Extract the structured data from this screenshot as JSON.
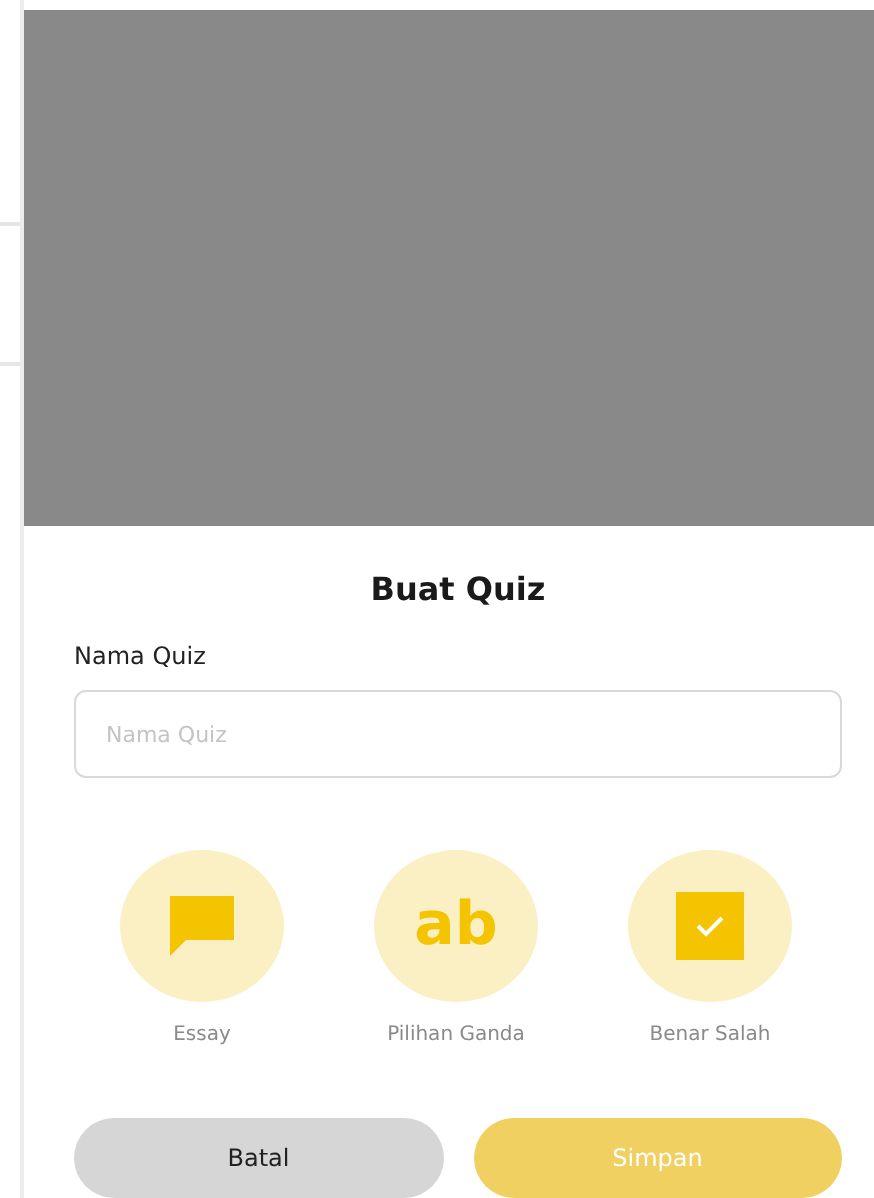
{
  "dialog": {
    "title": "Buat Quiz",
    "field": {
      "label": "Nama Quiz",
      "placeholder": "Nama Quiz"
    },
    "options": [
      {
        "kind": "chat",
        "label": "Essay"
      },
      {
        "kind": "text",
        "glyph": "ab",
        "label": "Pilihan Ganda"
      },
      {
        "kind": "check",
        "label": "Benar Salah"
      }
    ],
    "buttons": [
      {
        "kind": "cancel",
        "label": "Batal",
        "disabled": false
      },
      {
        "kind": "submit",
        "label": "Simpan",
        "disabled": true
      }
    ]
  }
}
